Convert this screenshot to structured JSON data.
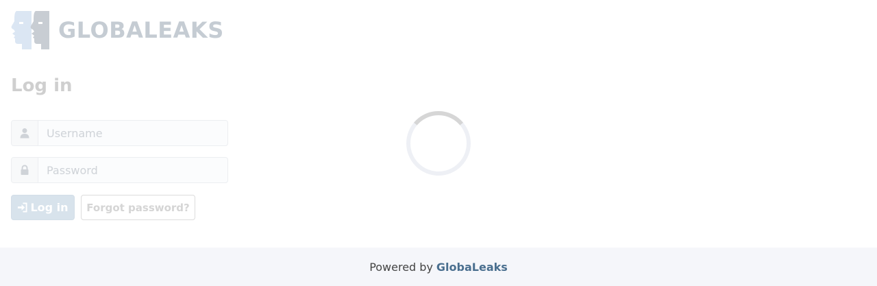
{
  "header": {
    "logo_text": "GLOBALEAKS",
    "logo_icon": "two-heads-logo-icon"
  },
  "login": {
    "title": "Log in",
    "username_placeholder": "Username",
    "password_placeholder": "Password",
    "username_icon": "user-icon",
    "password_icon": "lock-icon",
    "login_button_label": "Log in",
    "login_button_icon": "sign-in-icon",
    "forgot_password_label": "Forgot password?"
  },
  "loader": {
    "icon": "loading-spinner-icon"
  },
  "footer": {
    "powered_by": "Powered by",
    "brand": "GlobaLeaks"
  },
  "colors": {
    "brand_link": "#4a6f8f",
    "login_button_bg": "#d8e3ec",
    "footer_bg": "#f5f6fa",
    "logo_text": "#c5ccd3"
  }
}
